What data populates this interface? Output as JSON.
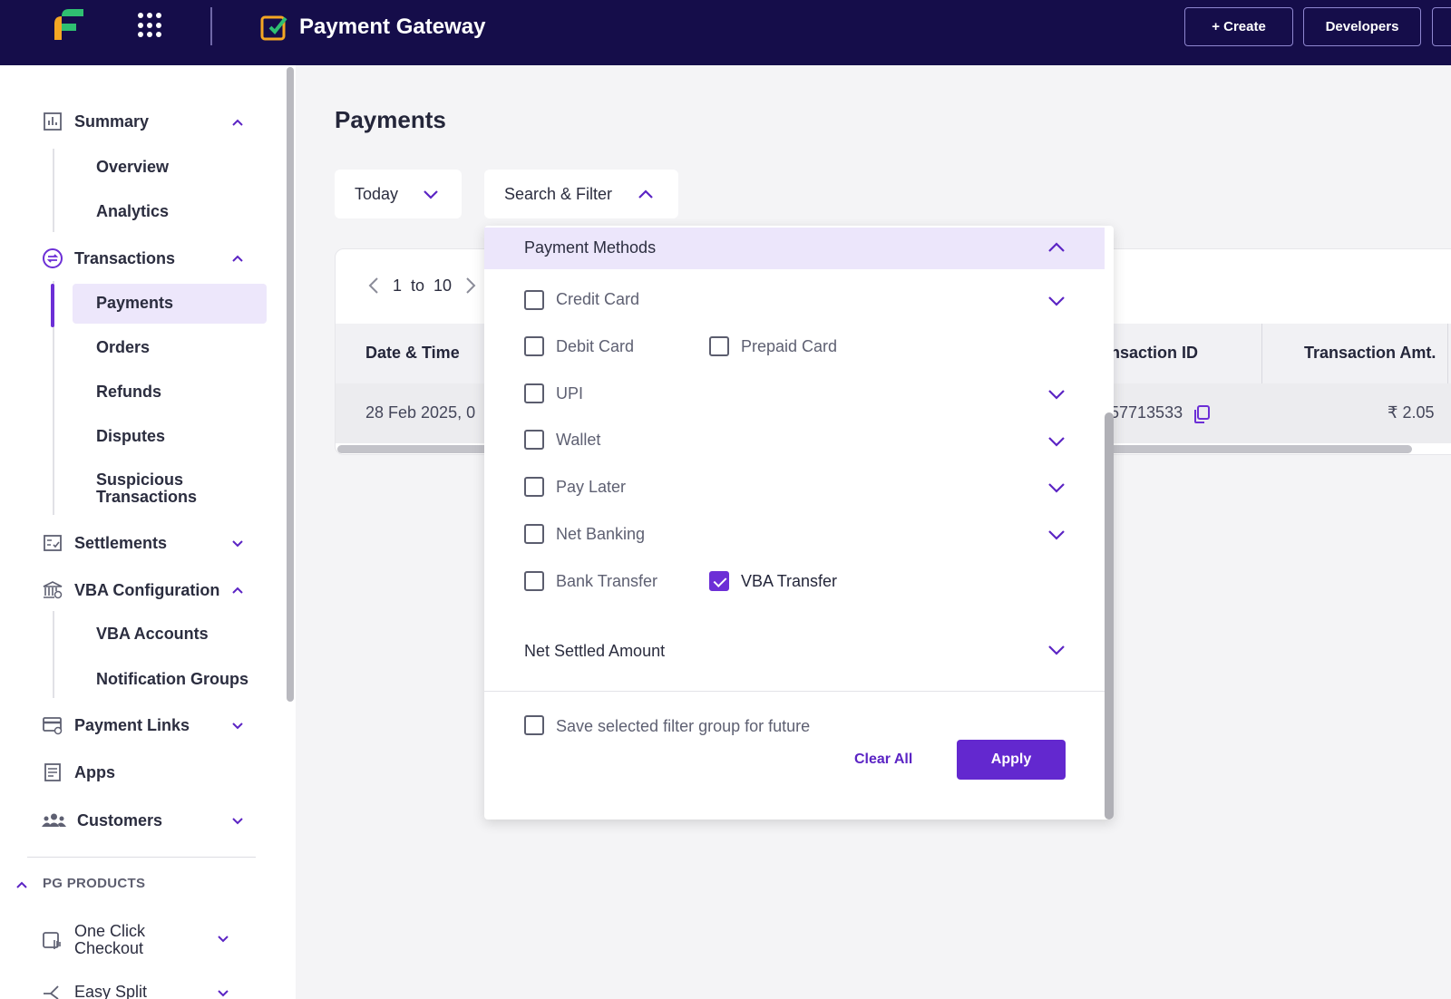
{
  "header": {
    "app_title": "Payment Gateway",
    "create_label": "+ Create",
    "developers_label": "Developers"
  },
  "sidebar": {
    "groups": [
      {
        "label": "Summary",
        "items": [
          "Overview",
          "Analytics"
        ]
      },
      {
        "label": "Transactions",
        "items": [
          "Payments",
          "Orders",
          "Refunds",
          "Disputes",
          "Suspicious Transactions"
        ]
      },
      {
        "label": "Settlements"
      },
      {
        "label": "VBA Configuration",
        "items": [
          "VBA Accounts",
          "Notification Groups"
        ]
      },
      {
        "label": "Payment Links"
      },
      {
        "label": "Apps"
      },
      {
        "label": "Customers"
      }
    ],
    "suspicious_line1": "Suspicious",
    "suspicious_line2": "Transactions",
    "section_label": "PG PRODUCTS",
    "products": [
      {
        "line1": "One Click",
        "line2": "Checkout"
      },
      {
        "line1": "Easy Split"
      }
    ],
    "active_item": "Payments"
  },
  "main": {
    "title": "Payments",
    "date_filter": "Today",
    "search_filter": "Search & Filter",
    "pager": {
      "from": "1",
      "to_word": "to",
      "to": "10"
    },
    "table": {
      "headers": [
        "Date & Time",
        "nsaction ID",
        "Transaction Amt."
      ],
      "row": {
        "date": "28 Feb 2025, 0",
        "txn_id": "57713533",
        "amount": "₹ 2.05"
      }
    }
  },
  "filter_panel": {
    "section_title": "Payment Methods",
    "methods": [
      {
        "label": "Credit Card",
        "checked": false
      },
      {
        "label": "Debit Card",
        "checked": false
      },
      {
        "label": "Prepaid Card",
        "checked": false
      },
      {
        "label": "UPI",
        "checked": false
      },
      {
        "label": "Wallet",
        "checked": false
      },
      {
        "label": "Pay Later",
        "checked": false
      },
      {
        "label": "Net Banking",
        "checked": false
      },
      {
        "label": "Bank Transfer",
        "checked": false
      },
      {
        "label": "VBA Transfer",
        "checked": true
      }
    ],
    "net_settled_label": "Net Settled Amount",
    "save_label": "Save selected filter group for future",
    "clear_label": "Clear All",
    "apply_label": "Apply"
  },
  "colors": {
    "brand_dark": "#150d4a",
    "accent_purple": "#6c2fd6",
    "logo_green": "#2fbf71",
    "logo_orange": "#f5a623"
  }
}
